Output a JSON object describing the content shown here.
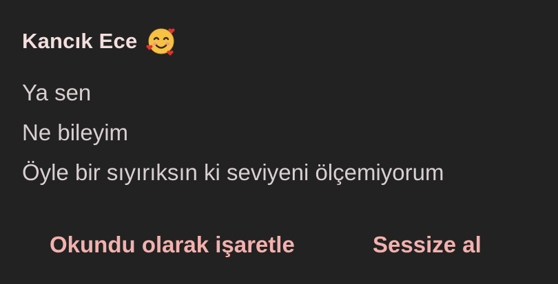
{
  "notification": {
    "sender": "Kancık Ece",
    "sender_emoji": "smiling-face-with-hearts-icon",
    "messages": [
      "Ya sen",
      "Ne bileyim",
      "Öyle bir sıyırıksın ki seviyeni ölçemiyorum"
    ],
    "actions": {
      "mark_read_label": "Okundu olarak işaretle",
      "mute_label": "Sessize al"
    }
  },
  "colors": {
    "background": "#222222",
    "sender_text": "#f3dede",
    "message_text": "#d9cfd0",
    "action_text": "#f3b1ad"
  }
}
